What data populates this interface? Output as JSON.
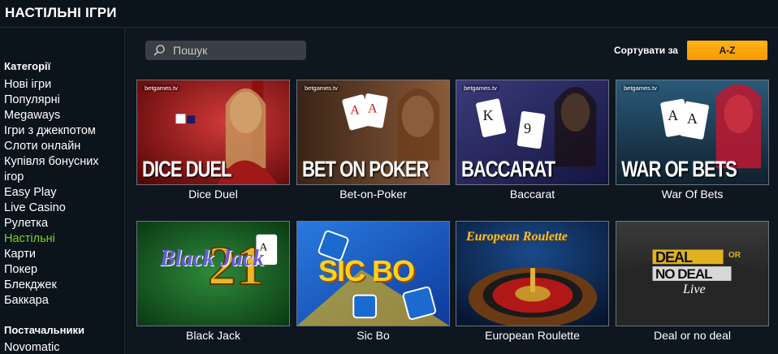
{
  "header": {
    "title": "НАСТІЛЬНІ ІГРИ"
  },
  "sidebar": {
    "categories_heading": "Категорії",
    "categories": [
      "Нові ігри",
      "Популярні",
      "Megaways",
      "Ігри з джекпотом",
      "Слоти онлайн",
      "Купівля бонусних",
      "ігор",
      "Easy Play",
      "Live Casino",
      "Рулетка",
      "Настільні",
      "Карти",
      "Покер",
      "Блекджек",
      "Баккара"
    ],
    "active_category": "Настільні",
    "providers_heading": "Постачальники",
    "providers": [
      "Novomatic"
    ]
  },
  "toolbar": {
    "search_placeholder": "Пошук",
    "sort_label": "Сортувати за",
    "sort_value": "A-Z",
    "accent_color": "#f5a000"
  },
  "games": [
    {
      "title": "Dice Duel",
      "thumb_text": "DICE DUEL",
      "brand": "betgames.tv"
    },
    {
      "title": "Bet-on-Poker",
      "thumb_text": "BET ON POKER",
      "brand": "betgames.tv"
    },
    {
      "title": "Baccarat",
      "thumb_text": "BACCARAT",
      "brand": "betgames.tv"
    },
    {
      "title": "War Of Bets",
      "thumb_text": "WAR OF BETS",
      "brand": "betgames.tv"
    },
    {
      "title": "Black Jack",
      "thumb_text": "Black Jack",
      "thumb_text2": "21"
    },
    {
      "title": "Sic Bo",
      "thumb_text": "SIC BO"
    },
    {
      "title": "European Roulette",
      "thumb_text": "European Roulette"
    },
    {
      "title": "Deal or no deal",
      "thumb_text": "DEAL",
      "thumb_text2": "NO DEAL",
      "thumb_text3": "OR",
      "thumb_text4": "Live"
    }
  ]
}
